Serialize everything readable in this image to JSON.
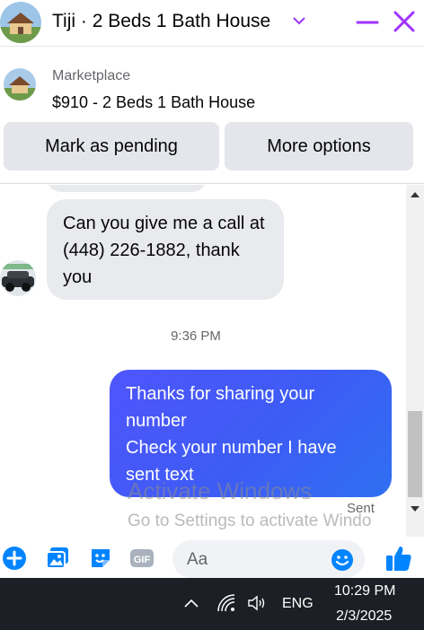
{
  "header": {
    "title": "Tiji · 2 Beds 1 Bath House",
    "icons": [
      "house-avatar",
      "chevron-down-icon",
      "minimize-icon",
      "close-icon"
    ]
  },
  "listing": {
    "source": "Marketplace",
    "name": "$910 - 2 Beds 1 Bath House",
    "mark_pending_label": "Mark as pending",
    "more_options_label": "More options"
  },
  "thread": {
    "incoming_message": "Can you give me a call at (448) 226-1882, thank you",
    "timestamp": "9:36 PM",
    "outgoing_message_lines": [
      "Thanks for sharing your",
      "number",
      "Check your number I have",
      "sent text"
    ],
    "status": "Sent"
  },
  "watermark": {
    "line1": "Activate Windows",
    "line2": "Go to Settings to activate Windo"
  },
  "composer": {
    "placeholder": "Aa",
    "icons": [
      "plus-icon",
      "photo-icon",
      "sticker-icon",
      "gif-icon",
      "emoji-icon",
      "thumbs-up-icon"
    ]
  },
  "taskbar": {
    "language": "ENG",
    "time": "10:29 PM",
    "date": "2/3/2025"
  },
  "colors": {
    "accent": "#0084ff",
    "violet": "#a033ff",
    "outgoing_bubble": "#4256f6",
    "incoming_bubble": "#e9eaed",
    "taskbar": "#1c1f25"
  }
}
